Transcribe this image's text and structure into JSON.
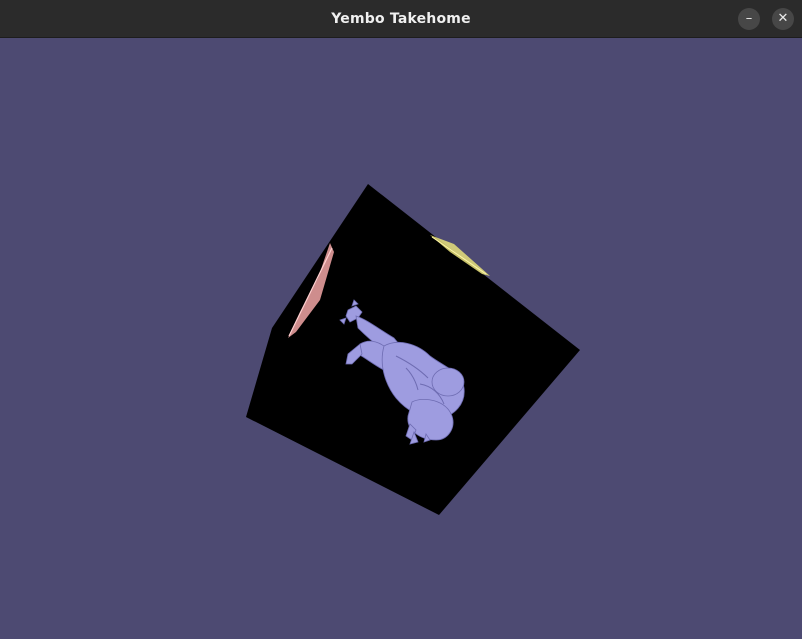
{
  "window": {
    "title": "Yembo Takehome",
    "minimize_symbol": "–",
    "close_symbol": "✕"
  },
  "scene": {
    "background_color": "#4d4a72",
    "cube_color": "#000000",
    "model_color": "#9e9ce0",
    "edge_highlights": [
      "#f2a6a6",
      "#e8e07a"
    ]
  }
}
